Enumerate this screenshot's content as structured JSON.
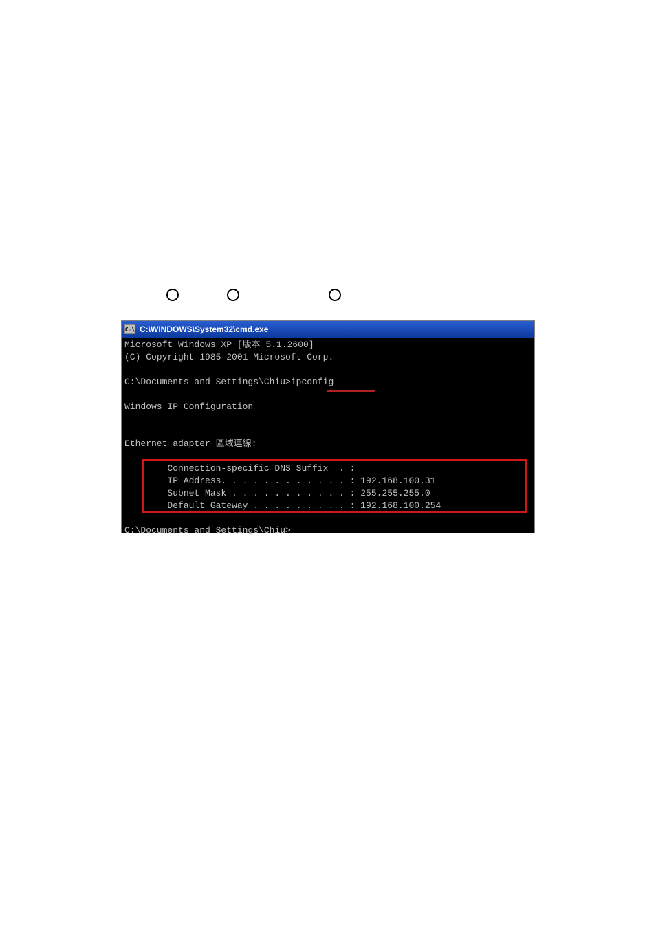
{
  "decorations": {
    "circles": [
      "O",
      "O",
      "O"
    ]
  },
  "window": {
    "titlebar_icon_text": "C:\\",
    "title": "C:\\WINDOWS\\System32\\cmd.exe"
  },
  "terminal": {
    "line1": "Microsoft Windows XP [版本 5.1.2600]",
    "line2": "(C) Copyright 1985-2001 Microsoft Corp.",
    "blank1": "",
    "prompt1": "C:\\Documents and Settings\\Chiu>ipconfig",
    "blank2": "",
    "header": "Windows IP Configuration",
    "blank3": "",
    "blank4": "",
    "adapter": "Ethernet adapter 區域連線:",
    "blank5": "",
    "dns": "        Connection-specific DNS Suffix  . :",
    "ip": "        IP Address. . . . . . . . . . . . : 192.168.100.31",
    "mask": "        Subnet Mask . . . . . . . . . . . : 255.255.255.0",
    "gateway": "        Default Gateway . . . . . . . . . : 192.168.100.254",
    "blank6": "",
    "prompt2": "C:\\Documents and Settings\\Chiu>"
  }
}
